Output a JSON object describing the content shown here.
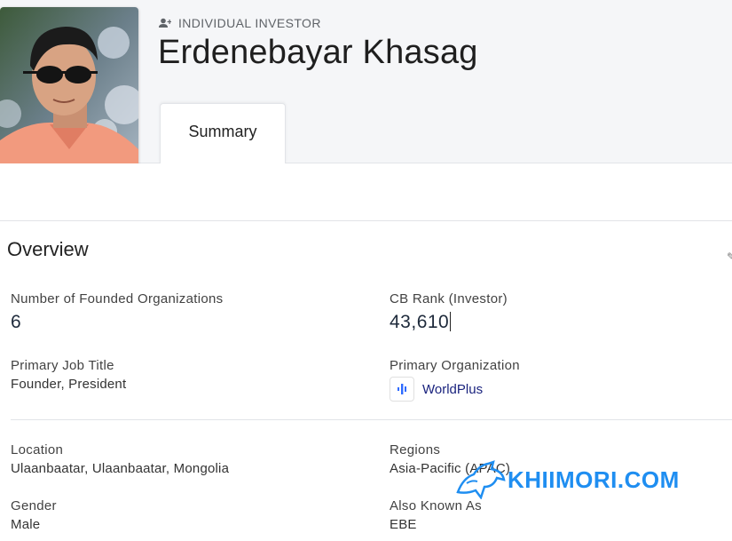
{
  "profile": {
    "type_label": "INDIVIDUAL INVESTOR",
    "name": "Erdenebayar Khasag",
    "type_icon": "person-add-icon",
    "avatar": "profile-photo"
  },
  "tabs": [
    {
      "label": "Summary",
      "active": true
    }
  ],
  "overview": {
    "title": "Overview",
    "fields": {
      "founded_orgs": {
        "label": "Number of Founded Organizations",
        "value": "6"
      },
      "cb_rank": {
        "label": "CB Rank (Investor)",
        "value": "43,610"
      },
      "job_title": {
        "label": "Primary Job Title",
        "value": "Founder, President"
      },
      "primary_org": {
        "label": "Primary Organization",
        "value": "WorldPlus",
        "icon": "worldplus-logo"
      },
      "location": {
        "label": "Location",
        "value": "Ulaanbaatar, Ulaanbaatar, Mongolia"
      },
      "regions": {
        "label": "Regions",
        "value": "Asia-Pacific (APAC)"
      },
      "gender": {
        "label": "Gender",
        "value": "Male"
      },
      "aka": {
        "label": "Also Known As",
        "value": "EBE"
      }
    }
  },
  "watermark": {
    "text": "KHIIMORI.COM",
    "color": "#1f8ef1"
  },
  "colors": {
    "header_bg": "#f5f6f8",
    "link": "#1a237e",
    "logo_blue": "#2f6bff"
  }
}
